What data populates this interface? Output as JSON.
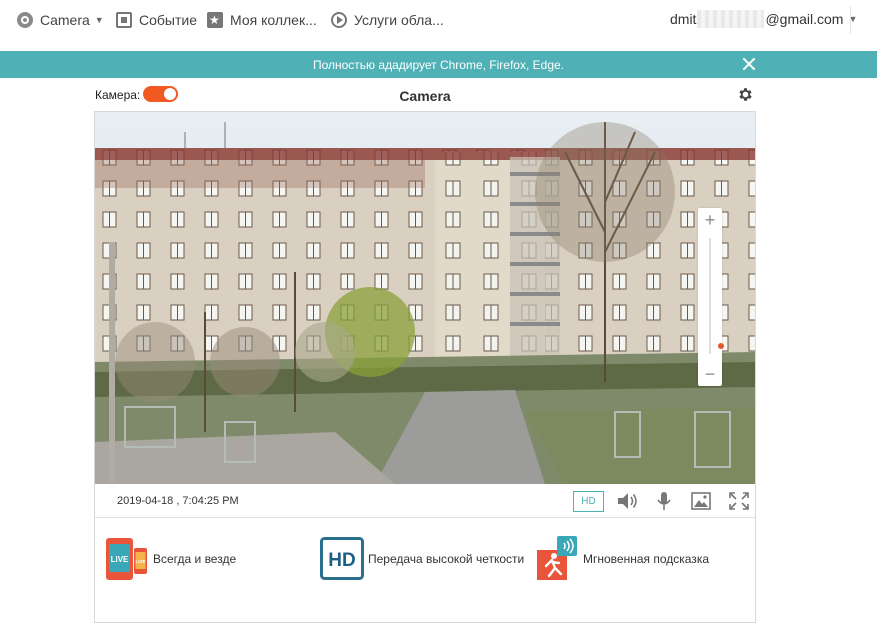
{
  "nav": {
    "items": [
      {
        "label": "Camera",
        "icon": "camera-icon",
        "has_caret": true
      },
      {
        "label": "Событие",
        "icon": "event-icon"
      },
      {
        "label": "Моя коллек...",
        "icon": "collection-icon"
      },
      {
        "label": "Услуги обла...",
        "icon": "cloud-play-icon"
      }
    ],
    "account_prefix": "dmit",
    "account_suffix": "@gmail.com"
  },
  "banner": {
    "text": "Полностью ададирует Chrome, Firefox, Edge."
  },
  "camera": {
    "toggle_label": "Камера:",
    "toggle_on": true,
    "title": "Camera"
  },
  "player": {
    "timestamp": "2019-04-18 , 7:04:25 PM",
    "hd_label": "HD",
    "zoom_level": 0.05
  },
  "features": [
    {
      "label": "Всегда и везде",
      "icon": "live-devices-icon",
      "icon_text_live": "LIVE",
      "icon_text_small": "LIVE"
    },
    {
      "label": "Передача высокой четкости",
      "icon": "hd-icon",
      "icon_text": "HD"
    },
    {
      "label": "Мгновенная подсказка",
      "icon": "motion-alert-icon"
    }
  ],
  "colors": {
    "accent": "#4fb0b6",
    "toggle": "#f05a22",
    "zoom_knob": "#e4572e"
  }
}
